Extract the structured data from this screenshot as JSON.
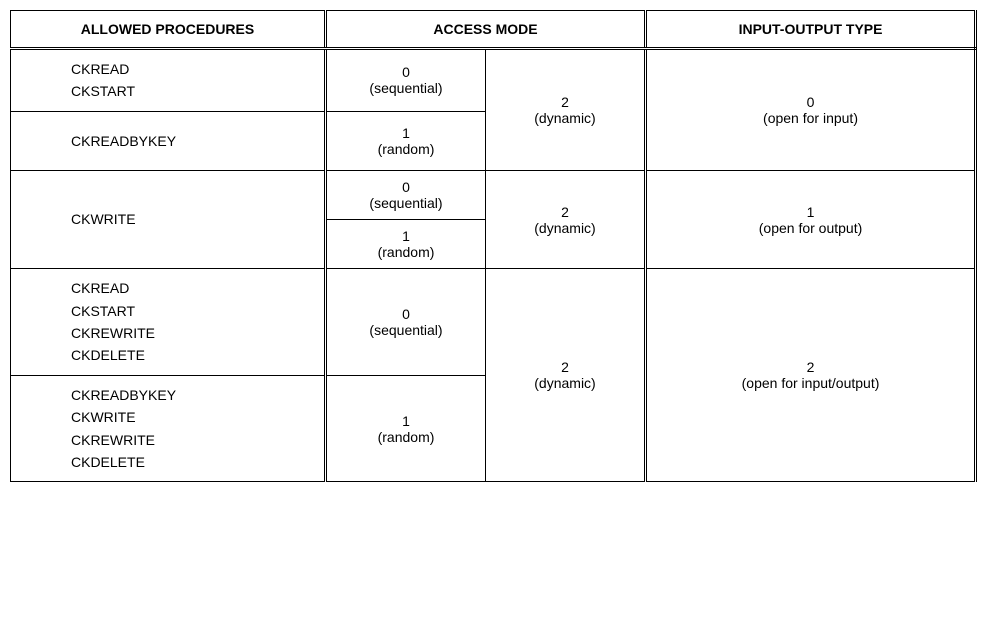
{
  "headers": {
    "procedures": "ALLOWED PROCEDURES",
    "access_mode": "ACCESS MODE",
    "io_type": "INPUT-OUTPUT TYPE"
  },
  "access": {
    "seq_num": "0",
    "seq_lbl": "(sequential)",
    "rnd_num": "1",
    "rnd_lbl": "(random)",
    "dyn_num": "2",
    "dyn_lbl": "(dynamic)"
  },
  "io": {
    "input_num": "0",
    "input_lbl": "(open for input)",
    "output_num": "1",
    "output_lbl": "(open for output)",
    "io_num": "2",
    "io_lbl": "(open for input/output)"
  },
  "procs": {
    "r1a": "CKREAD",
    "r1b": "CKSTART",
    "r2a": "CKREADBYKEY",
    "r3a": "CKWRITE",
    "r5a": "CKREAD",
    "r5b": "CKSTART",
    "r5c": "CKREWRITE",
    "r5d": "CKDELETE",
    "r6a": "CKREADBYKEY",
    "r6b": "CKWRITE",
    "r6c": "CKREWRITE",
    "r6d": "CKDELETE"
  }
}
